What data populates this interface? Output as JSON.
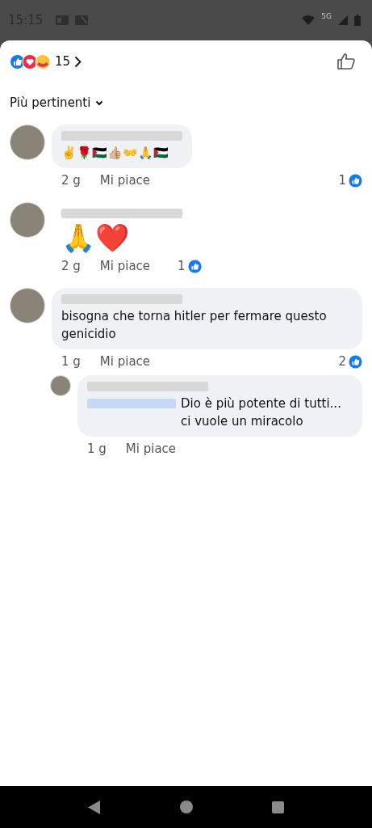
{
  "status_bar": {
    "time": "15:15",
    "network": "5G"
  },
  "reactions": {
    "count": "15"
  },
  "sort": {
    "label": "Più pertinenti"
  },
  "comments": [
    {
      "kind": "text",
      "text": "✌️🌹🇵🇸👍🏼👐🙏🇵🇸",
      "time": "2 g",
      "like_label": "Mi piace",
      "likes": "1"
    },
    {
      "kind": "emoji",
      "text": "🙏❤️",
      "time": "2 g",
      "like_label": "Mi piace",
      "likes": "1"
    },
    {
      "kind": "text",
      "text": "bisogna che torna hitler per fermare questo genicidio",
      "time": "1 g",
      "like_label": "Mi piace",
      "likes": "2",
      "children": [
        {
          "mention": true,
          "text": "Dio è più potente di tutti... ci vuole un miracolo",
          "time": "1 g",
          "like_label": "Mi piace"
        }
      ]
    }
  ]
}
